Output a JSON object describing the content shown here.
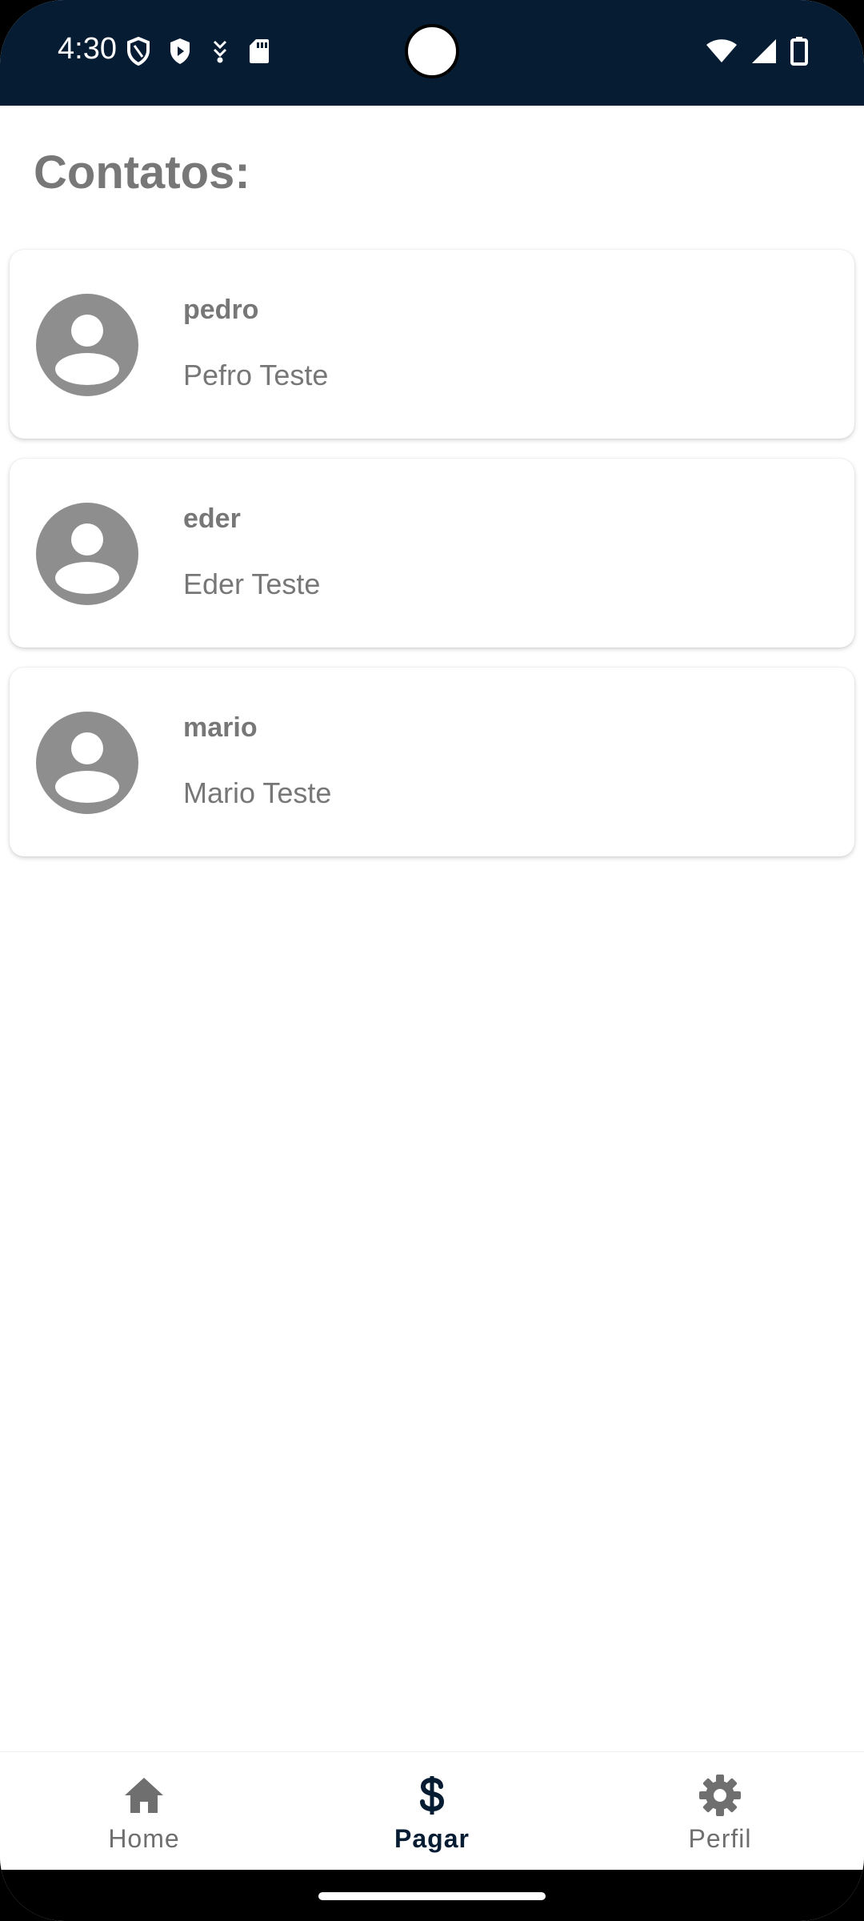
{
  "status_bar": {
    "time": "4:30",
    "left_icons": [
      "shield-outline-icon",
      "play-protect-icon",
      "download-icon",
      "sd-card-icon"
    ],
    "right_icons": [
      "wifi-icon",
      "signal-icon",
      "battery-icon"
    ],
    "background": "#061c33"
  },
  "page": {
    "title": "Contatos:"
  },
  "contacts": [
    {
      "username": "pedro",
      "full_name": "Pefro Teste"
    },
    {
      "username": "eder",
      "full_name": "Eder Teste"
    },
    {
      "username": "mario",
      "full_name": "Mario Teste"
    }
  ],
  "bottom_nav": {
    "items": [
      {
        "label": "Home",
        "icon": "home-icon",
        "active": false
      },
      {
        "label": "Pagar",
        "icon": "dollar-icon",
        "active": true
      },
      {
        "label": "Perfil",
        "icon": "gear-icon",
        "active": false
      }
    ],
    "active_color": "#061c33",
    "inactive_color": "#6f6f6f"
  },
  "colors": {
    "text_gray": "#777777",
    "avatar_gray": "#8e8e8e"
  }
}
